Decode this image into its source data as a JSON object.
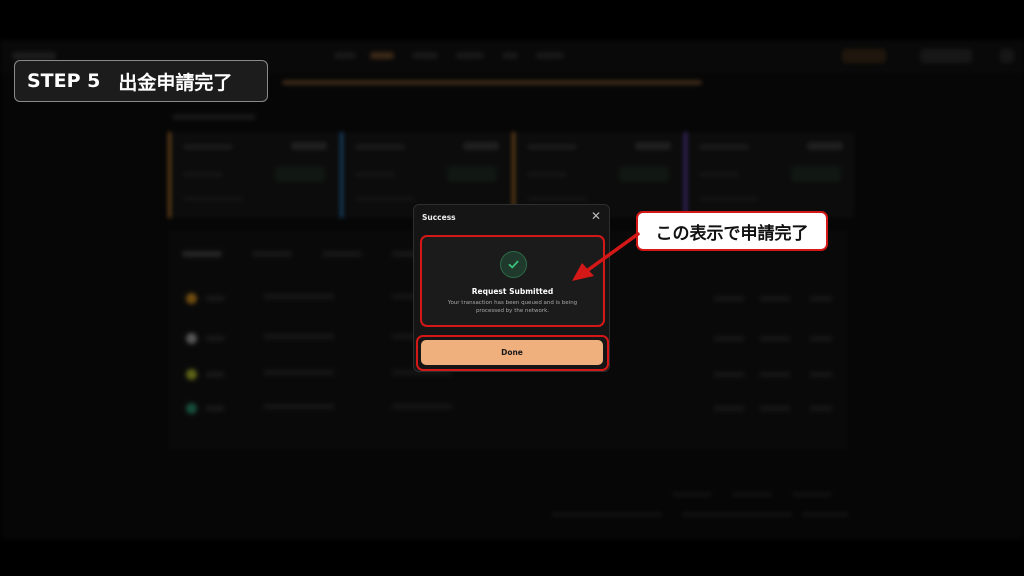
{
  "step_label": {
    "step": "STEP 5",
    "title": "出金申請完了"
  },
  "modal": {
    "title": "Success",
    "close_glyph": "✕",
    "heading": "Request Submitted",
    "description": "Your transaction has been queued and is being processed by the network.",
    "done_label": "Done"
  },
  "callout": {
    "text": "この表示で申請完了"
  },
  "colors": {
    "highlight_red": "#d41717",
    "done_button": "#f0b07e",
    "check_green": "#3bbf7a",
    "card_accents": [
      "#c07a2a",
      "#2a7ac0",
      "#c07a2a",
      "#6a4ac0"
    ],
    "coin_colors": [
      "#c98a1e",
      "#9a9a9a",
      "#a8b02a",
      "#2a8a6a"
    ]
  },
  "icons": {
    "modal_check": "check-circle-icon",
    "close": "close-icon"
  }
}
